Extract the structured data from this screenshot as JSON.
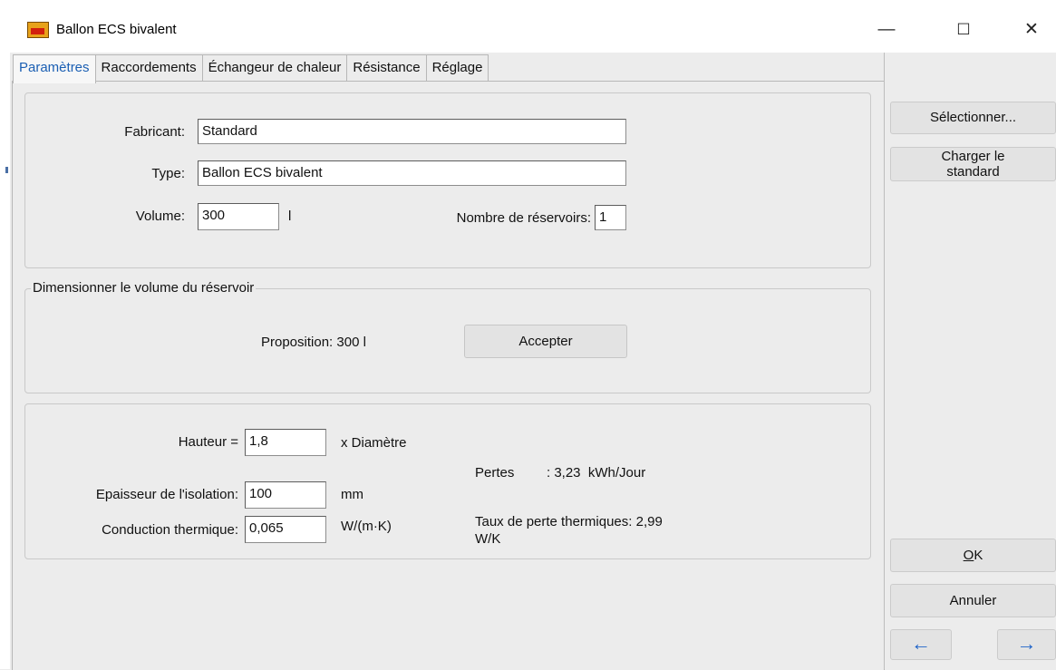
{
  "window": {
    "title": "Ballon ECS bivalent",
    "minimize_glyph": "—",
    "maximize_glyph": "☐",
    "close_glyph": "✕"
  },
  "tabs": [
    {
      "label": "Paramètres",
      "active": true
    },
    {
      "label": "Raccordements",
      "active": false
    },
    {
      "label": "Échangeur de chaleur",
      "active": false
    },
    {
      "label": "Résistance",
      "active": false
    },
    {
      "label": "Réglage",
      "active": false
    }
  ],
  "params": {
    "fabricant_label": "Fabricant:",
    "fabricant_value": "Standard",
    "type_label": "Type:",
    "type_value": "Ballon ECS bivalent",
    "volume_label": "Volume:",
    "volume_value": "300",
    "volume_unit": "l",
    "reservoirs_label": "Nombre de réservoirs:",
    "reservoirs_value": "1"
  },
  "sizing": {
    "legend": "Dimensionner le volume du réservoir",
    "proposition": "Proposition: 300 l",
    "accept_button": "Accepter"
  },
  "geometry": {
    "hauteur_label": "Hauteur =",
    "hauteur_value": "1,8",
    "hauteur_unit": "x Diamètre",
    "isolation_label": "Epaisseur de l'isolation:",
    "isolation_value": "100",
    "isolation_unit": "mm",
    "conduction_label": "Conduction thermique:",
    "conduction_value": "0,065",
    "conduction_unit": "W/(m·K)",
    "pertes_label": "Pertes",
    "pertes_value": ": 3,23  kWh/Jour",
    "taux_line1": "Taux de perte thermiques: 2,99",
    "taux_line2": "W/K"
  },
  "sidebar": {
    "select_button": "Sélectionner...",
    "load_standard_line1": "Charger le",
    "load_standard_line2": "standard",
    "ok_rest": "K",
    "ok_mnemonic": "O",
    "cancel_button": "Annuler",
    "prev_icon": "arrow-left-icon",
    "next_icon": "arrow-right-icon",
    "arrow_color": "#1f64c9"
  }
}
